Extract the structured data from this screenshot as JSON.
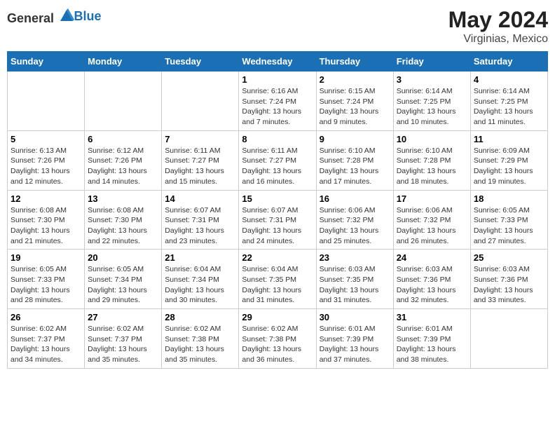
{
  "header": {
    "logo_general": "General",
    "logo_blue": "Blue",
    "main_title": "May 2024",
    "subtitle": "Virginias, Mexico"
  },
  "calendar": {
    "days_of_week": [
      "Sunday",
      "Monday",
      "Tuesday",
      "Wednesday",
      "Thursday",
      "Friday",
      "Saturday"
    ],
    "weeks": [
      [
        {
          "day": "",
          "info": ""
        },
        {
          "day": "",
          "info": ""
        },
        {
          "day": "",
          "info": ""
        },
        {
          "day": "1",
          "sunrise": "6:16 AM",
          "sunset": "7:24 PM",
          "daylight": "13 hours and 7 minutes."
        },
        {
          "day": "2",
          "sunrise": "6:15 AM",
          "sunset": "7:24 PM",
          "daylight": "13 hours and 9 minutes."
        },
        {
          "day": "3",
          "sunrise": "6:14 AM",
          "sunset": "7:25 PM",
          "daylight": "13 hours and 10 minutes."
        },
        {
          "day": "4",
          "sunrise": "6:14 AM",
          "sunset": "7:25 PM",
          "daylight": "13 hours and 11 minutes."
        }
      ],
      [
        {
          "day": "5",
          "sunrise": "6:13 AM",
          "sunset": "7:26 PM",
          "daylight": "13 hours and 12 minutes."
        },
        {
          "day": "6",
          "sunrise": "6:12 AM",
          "sunset": "7:26 PM",
          "daylight": "13 hours and 14 minutes."
        },
        {
          "day": "7",
          "sunrise": "6:11 AM",
          "sunset": "7:27 PM",
          "daylight": "13 hours and 15 minutes."
        },
        {
          "day": "8",
          "sunrise": "6:11 AM",
          "sunset": "7:27 PM",
          "daylight": "13 hours and 16 minutes."
        },
        {
          "day": "9",
          "sunrise": "6:10 AM",
          "sunset": "7:28 PM",
          "daylight": "13 hours and 17 minutes."
        },
        {
          "day": "10",
          "sunrise": "6:10 AM",
          "sunset": "7:28 PM",
          "daylight": "13 hours and 18 minutes."
        },
        {
          "day": "11",
          "sunrise": "6:09 AM",
          "sunset": "7:29 PM",
          "daylight": "13 hours and 19 minutes."
        }
      ],
      [
        {
          "day": "12",
          "sunrise": "6:08 AM",
          "sunset": "7:30 PM",
          "daylight": "13 hours and 21 minutes."
        },
        {
          "day": "13",
          "sunrise": "6:08 AM",
          "sunset": "7:30 PM",
          "daylight": "13 hours and 22 minutes."
        },
        {
          "day": "14",
          "sunrise": "6:07 AM",
          "sunset": "7:31 PM",
          "daylight": "13 hours and 23 minutes."
        },
        {
          "day": "15",
          "sunrise": "6:07 AM",
          "sunset": "7:31 PM",
          "daylight": "13 hours and 24 minutes."
        },
        {
          "day": "16",
          "sunrise": "6:06 AM",
          "sunset": "7:32 PM",
          "daylight": "13 hours and 25 minutes."
        },
        {
          "day": "17",
          "sunrise": "6:06 AM",
          "sunset": "7:32 PM",
          "daylight": "13 hours and 26 minutes."
        },
        {
          "day": "18",
          "sunrise": "6:05 AM",
          "sunset": "7:33 PM",
          "daylight": "13 hours and 27 minutes."
        }
      ],
      [
        {
          "day": "19",
          "sunrise": "6:05 AM",
          "sunset": "7:33 PM",
          "daylight": "13 hours and 28 minutes."
        },
        {
          "day": "20",
          "sunrise": "6:05 AM",
          "sunset": "7:34 PM",
          "daylight": "13 hours and 29 minutes."
        },
        {
          "day": "21",
          "sunrise": "6:04 AM",
          "sunset": "7:34 PM",
          "daylight": "13 hours and 30 minutes."
        },
        {
          "day": "22",
          "sunrise": "6:04 AM",
          "sunset": "7:35 PM",
          "daylight": "13 hours and 31 minutes."
        },
        {
          "day": "23",
          "sunrise": "6:03 AM",
          "sunset": "7:35 PM",
          "daylight": "13 hours and 31 minutes."
        },
        {
          "day": "24",
          "sunrise": "6:03 AM",
          "sunset": "7:36 PM",
          "daylight": "13 hours and 32 minutes."
        },
        {
          "day": "25",
          "sunrise": "6:03 AM",
          "sunset": "7:36 PM",
          "daylight": "13 hours and 33 minutes."
        }
      ],
      [
        {
          "day": "26",
          "sunrise": "6:02 AM",
          "sunset": "7:37 PM",
          "daylight": "13 hours and 34 minutes."
        },
        {
          "day": "27",
          "sunrise": "6:02 AM",
          "sunset": "7:37 PM",
          "daylight": "13 hours and 35 minutes."
        },
        {
          "day": "28",
          "sunrise": "6:02 AM",
          "sunset": "7:38 PM",
          "daylight": "13 hours and 35 minutes."
        },
        {
          "day": "29",
          "sunrise": "6:02 AM",
          "sunset": "7:38 PM",
          "daylight": "13 hours and 36 minutes."
        },
        {
          "day": "30",
          "sunrise": "6:01 AM",
          "sunset": "7:39 PM",
          "daylight": "13 hours and 37 minutes."
        },
        {
          "day": "31",
          "sunrise": "6:01 AM",
          "sunset": "7:39 PM",
          "daylight": "13 hours and 38 minutes."
        },
        {
          "day": "",
          "info": ""
        }
      ]
    ]
  }
}
